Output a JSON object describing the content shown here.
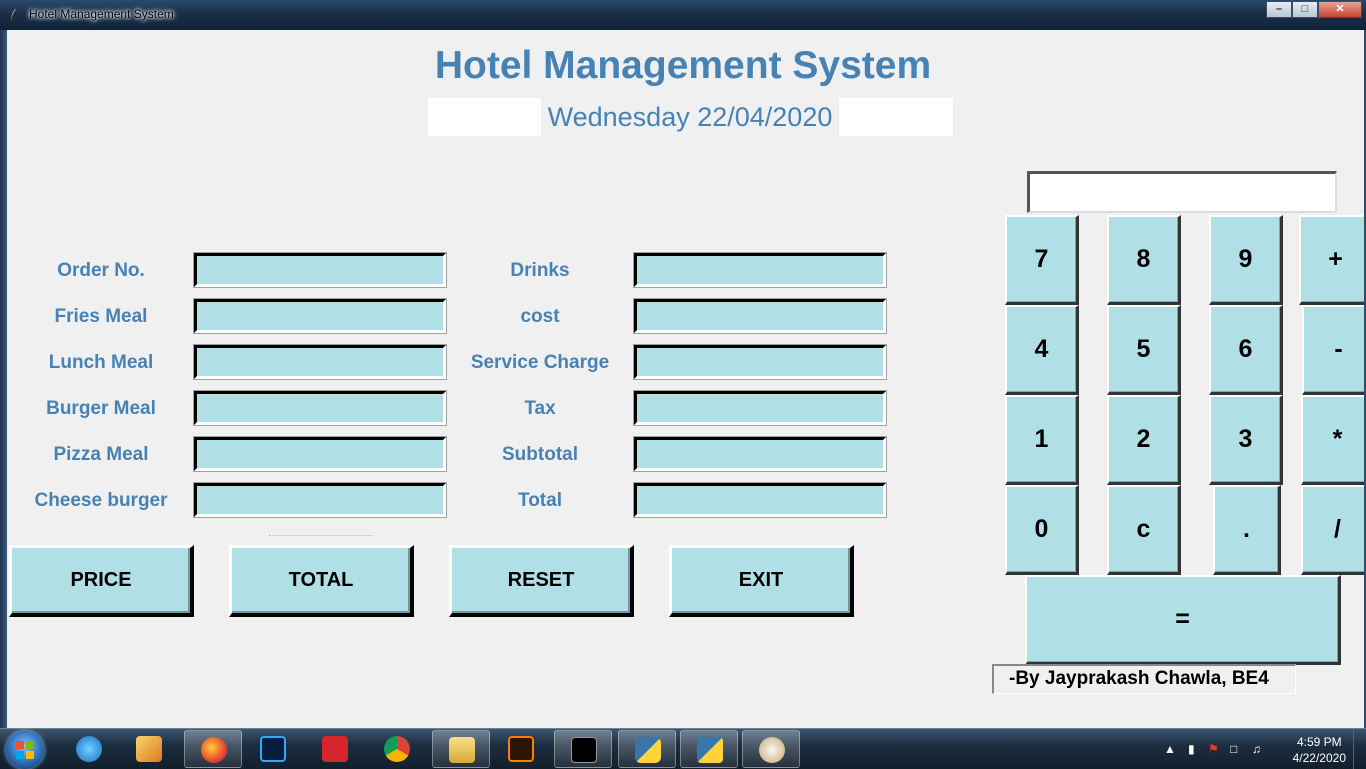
{
  "window": {
    "title": "Hotel Management System",
    "minimize": "–",
    "maximize": "□",
    "close": "✕"
  },
  "app": {
    "title": "Hotel Management System",
    "date": "Wednesday 22/04/2020"
  },
  "left_fields": [
    {
      "label": "Order No.",
      "value": ""
    },
    {
      "label": "Fries Meal",
      "value": ""
    },
    {
      "label": "Lunch Meal",
      "value": ""
    },
    {
      "label": "Burger Meal",
      "value": ""
    },
    {
      "label": "Pizza Meal",
      "value": ""
    },
    {
      "label": "Cheese burger",
      "value": ""
    }
  ],
  "right_fields": [
    {
      "label": "Drinks",
      "value": ""
    },
    {
      "label": "cost",
      "value": ""
    },
    {
      "label": "Service Charge",
      "value": ""
    },
    {
      "label": "Tax",
      "value": ""
    },
    {
      "label": "Subtotal",
      "value": ""
    },
    {
      "label": "Total",
      "value": ""
    }
  ],
  "actions": {
    "price": "PRICE",
    "total": "TOTAL",
    "reset": "RESET",
    "exit": "EXIT"
  },
  "calculator": {
    "display": "",
    "keys": [
      "7",
      "8",
      "9",
      "+",
      "4",
      "5",
      "6",
      "-",
      "1",
      "2",
      "3",
      "*",
      "0",
      "c",
      ".",
      "/"
    ],
    "equals": "="
  },
  "credit": "-By Jayprakash Chawla, BE4",
  "taskbar": {
    "apps": [
      "internet-explorer",
      "media-player",
      "firefox",
      "photoshop",
      "sketchup",
      "chrome",
      "file-explorer",
      "illustrator",
      "command-prompt",
      "python-launcher",
      "python-idle",
      "paint"
    ],
    "time": "4:59 PM",
    "date": "4/22/2020"
  },
  "colors": {
    "accent": "#4682b4",
    "field_bg": "#b0e0e6",
    "client_bg": "#f0f0f0"
  }
}
